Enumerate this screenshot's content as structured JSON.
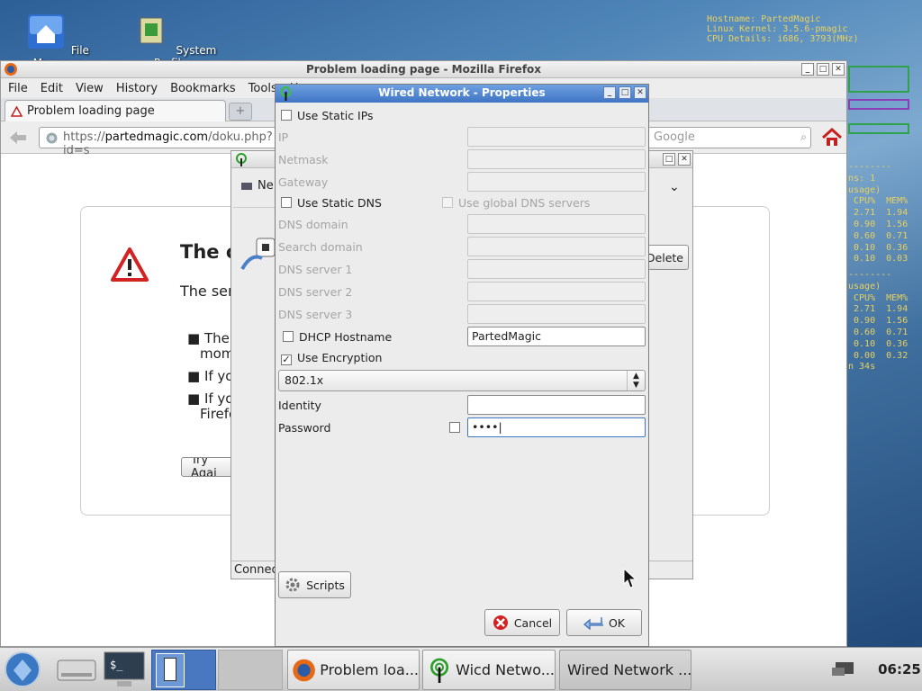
{
  "desktop": {
    "icons": [
      {
        "label": "File Manager"
      },
      {
        "label": "System Profiler"
      }
    ],
    "conky": {
      "hostname": "Hostname: PartedMagic",
      "kernel": "Linux Kernel: 3.5.6-pmagic",
      "cpu": "CPU Details: i686, 3793(MHz)",
      "lines_top": "--------\nns: 1\nusage)\n CPU%  MEM%\n 2.71  1.94\n 0.90  1.56\n 0.60  0.71\n 0.10  0.36\n 0.10  0.03",
      "lines_bottom": "--------\nusage)\n CPU%  MEM%\n 2.71  1.94\n 0.90  1.56\n 0.60  0.71\n 0.10  0.36\n 0.00  0.32\nn 34s"
    }
  },
  "firefox": {
    "title": "Problem loading page - Mozilla Firefox",
    "menu": [
      "File",
      "Edit",
      "View",
      "History",
      "Bookmarks",
      "Tools",
      "H"
    ],
    "tab_label": "Problem loading page",
    "url_prefix": "https://",
    "url_host": "partedmagic.com",
    "url_rest": "/doku.php?id=s",
    "search_placeholder": "Google",
    "error_title": "The co",
    "error_text": "The serv",
    "bullets": [
      "The s",
      "mom",
      "If you",
      "If you",
      "Firefo"
    ],
    "try_again": "Try Agai"
  },
  "wicd_window": {
    "network_label": "Ne",
    "delete_label": "Delete",
    "status": "Connec"
  },
  "dialog": {
    "title": "Wired Network - Properties",
    "use_static_ips": "Use Static IPs",
    "ip": "IP",
    "netmask": "Netmask",
    "gateway": "Gateway",
    "use_static_dns": "Use Static DNS",
    "use_global_dns": "Use global DNS servers",
    "dns_domain": "DNS domain",
    "search_domain": "Search domain",
    "dns1": "DNS server 1",
    "dns2": "DNS server 2",
    "dns3": "DNS server 3",
    "dhcp_hostname": "DHCP Hostname",
    "dhcp_value": "PartedMagic",
    "use_encryption": "Use Encryption",
    "encryption_type": "802.1x",
    "identity": "Identity",
    "identity_value": "",
    "password": "Password",
    "password_value": "••••",
    "scripts": "Scripts",
    "cancel": "Cancel",
    "ok": "OK"
  },
  "taskbar": {
    "tasks": [
      "Problem loa...",
      "Wicd Netwo...",
      "Wired Network ..."
    ],
    "clock": "06:25"
  },
  "colors": {
    "title_blue": "#3f75c5",
    "error_red": "#d42121",
    "conky_yellow": "#e8d060"
  }
}
